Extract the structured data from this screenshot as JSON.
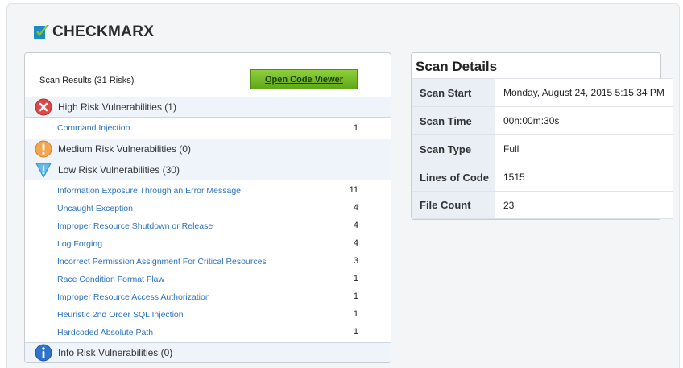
{
  "brand": {
    "name": "CHECKMARX"
  },
  "results": {
    "title": "Scan Results (31 Risks)",
    "open_button": "Open Code Viewer",
    "groups": [
      {
        "label": "High Risk Vulnerabilities (1)",
        "icon": "error-x-icon",
        "color": "#e24b4b",
        "items": [
          {
            "label": "Command Injection",
            "count": "1"
          }
        ]
      },
      {
        "label": "Medium Risk Vulnerabilities (0)",
        "icon": "warning-exclamation-icon",
        "color": "#f2a14a",
        "items": []
      },
      {
        "label": "Low Risk Vulnerabilities (30)",
        "icon": "warning-triangle-icon",
        "color": "#59b7e8",
        "items": [
          {
            "label": "Information Exposure Through an Error Message",
            "count": "11"
          },
          {
            "label": "Uncaught Exception",
            "count": "4"
          },
          {
            "label": "Improper Resource Shutdown or Release",
            "count": "4"
          },
          {
            "label": "Log Forging",
            "count": "4"
          },
          {
            "label": "Incorrect Permission Assignment For Critical Resources",
            "count": "3"
          },
          {
            "label": "Race Condition Format Flaw",
            "count": "1"
          },
          {
            "label": "Improper Resource Access Authorization",
            "count": "1"
          },
          {
            "label": "Heuristic 2nd Order SQL Injection",
            "count": "1"
          },
          {
            "label": "Hardcoded Absolute Path",
            "count": "1"
          }
        ]
      },
      {
        "label": "Info Risk Vulnerabilities (0)",
        "icon": "info-icon",
        "color": "#2f72c9",
        "items": []
      }
    ]
  },
  "details": {
    "title": "Scan Details",
    "rows": [
      {
        "key": "Scan Start",
        "value": "Monday, August 24, 2015 5:15:34 PM"
      },
      {
        "key": "Scan Time",
        "value": "00h:00m:30s"
      },
      {
        "key": "Scan Type",
        "value": "Full"
      },
      {
        "key": "Lines of Code",
        "value": "1515"
      },
      {
        "key": "File Count",
        "value": "23"
      }
    ]
  }
}
